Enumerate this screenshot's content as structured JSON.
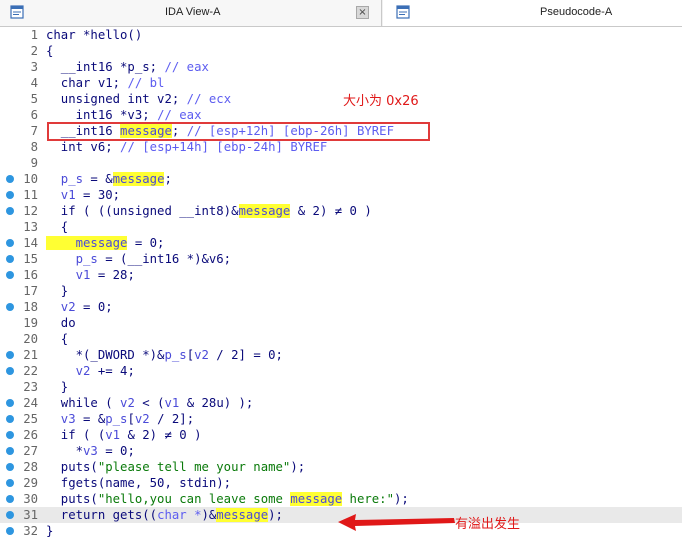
{
  "tabs": [
    {
      "title": "IDA View-A",
      "icon": "disassembly-view-icon",
      "close_glyph": "×"
    },
    {
      "title": "Pseudocode-A",
      "icon": "pseudocode-view-icon"
    }
  ],
  "annotations": {
    "size_note": "大小为 0x26",
    "overflow_note": "有溢出发生"
  },
  "colors": {
    "breakpoint": "#2e96e0",
    "highlight": "#ffff33",
    "annotation": "#e01818"
  },
  "code": {
    "lines": [
      {
        "n": "1",
        "bp": false,
        "parts": [
          [
            "k",
            "char *hello()"
          ]
        ]
      },
      {
        "n": "2",
        "bp": false,
        "parts": [
          [
            "k",
            "{"
          ]
        ]
      },
      {
        "n": "3",
        "bp": false,
        "parts": [
          [
            "k",
            "  __int16 *p_s; "
          ],
          [
            "c",
            "// eax"
          ]
        ]
      },
      {
        "n": "4",
        "bp": false,
        "parts": [
          [
            "k",
            "  char v1; "
          ],
          [
            "c",
            "// bl"
          ]
        ]
      },
      {
        "n": "5",
        "bp": false,
        "parts": [
          [
            "k",
            "  unsigned int v2; "
          ],
          [
            "c",
            "// ecx"
          ]
        ]
      },
      {
        "n": "6",
        "bp": false,
        "parts": [
          [
            "k",
            "    int16 *v3; "
          ],
          [
            "c",
            "// eax"
          ]
        ]
      },
      {
        "n": "7",
        "bp": false,
        "parts": [
          [
            "k",
            "  __int16 "
          ],
          [
            "y",
            "message"
          ],
          [
            "k",
            "; "
          ],
          [
            "c",
            "// [esp+12h] [ebp-26h] BYREF"
          ]
        ]
      },
      {
        "n": "8",
        "bp": false,
        "parts": [
          [
            "k",
            "  int v6; "
          ],
          [
            "c",
            "// [esp+14h] [ebp-24h] BYREF"
          ]
        ]
      },
      {
        "n": "9",
        "bp": false,
        "parts": [
          [
            "k",
            ""
          ]
        ]
      },
      {
        "n": "10",
        "bp": true,
        "parts": [
          [
            "v",
            "  p_s"
          ],
          [
            "k",
            " = &"
          ],
          [
            "y",
            "message"
          ],
          [
            "k",
            ";"
          ]
        ]
      },
      {
        "n": "11",
        "bp": true,
        "parts": [
          [
            "v",
            "  v1"
          ],
          [
            "k",
            " = 30;"
          ]
        ]
      },
      {
        "n": "12",
        "bp": true,
        "parts": [
          [
            "k",
            "  if ( ((unsigned __int8)&"
          ],
          [
            "y",
            "message"
          ],
          [
            "k",
            " & 2) ≠ 0 )"
          ]
        ]
      },
      {
        "n": "13",
        "bp": false,
        "parts": [
          [
            "k",
            "  {"
          ]
        ]
      },
      {
        "n": "14",
        "bp": true,
        "parts": [
          [
            "y",
            "    message"
          ],
          [
            "k",
            " = 0;"
          ]
        ]
      },
      {
        "n": "15",
        "bp": true,
        "parts": [
          [
            "v",
            "    p_s"
          ],
          [
            "k",
            " = (__int16 *)&v6;"
          ]
        ]
      },
      {
        "n": "16",
        "bp": true,
        "parts": [
          [
            "v",
            "    v1"
          ],
          [
            "k",
            " = 28;"
          ]
        ]
      },
      {
        "n": "17",
        "bp": false,
        "parts": [
          [
            "k",
            "  }"
          ]
        ]
      },
      {
        "n": "18",
        "bp": true,
        "parts": [
          [
            "v",
            "  v2"
          ],
          [
            "k",
            " = 0;"
          ]
        ]
      },
      {
        "n": "19",
        "bp": false,
        "parts": [
          [
            "k",
            "  do"
          ]
        ]
      },
      {
        "n": "20",
        "bp": false,
        "parts": [
          [
            "k",
            "  {"
          ]
        ]
      },
      {
        "n": "21",
        "bp": true,
        "parts": [
          [
            "k",
            "    *(_DWORD *)&"
          ],
          [
            "v",
            "p_s"
          ],
          [
            "k",
            "["
          ],
          [
            "v",
            "v2"
          ],
          [
            "k",
            " / 2] = 0;"
          ]
        ]
      },
      {
        "n": "22",
        "bp": true,
        "parts": [
          [
            "v",
            "    v2"
          ],
          [
            "k",
            " += 4;"
          ]
        ]
      },
      {
        "n": "23",
        "bp": false,
        "parts": [
          [
            "k",
            "  }"
          ]
        ]
      },
      {
        "n": "24",
        "bp": true,
        "parts": [
          [
            "k",
            "  while ( "
          ],
          [
            "v",
            "v2"
          ],
          [
            "k",
            " < ("
          ],
          [
            "v",
            "v1"
          ],
          [
            "k",
            " & 28u) );"
          ]
        ]
      },
      {
        "n": "25",
        "bp": true,
        "parts": [
          [
            "v",
            "  v3"
          ],
          [
            "k",
            " = &"
          ],
          [
            "v",
            "p_s"
          ],
          [
            "k",
            "["
          ],
          [
            "v",
            "v2"
          ],
          [
            "k",
            " / 2];"
          ]
        ]
      },
      {
        "n": "26",
        "bp": true,
        "parts": [
          [
            "k",
            "  if ( ("
          ],
          [
            "v",
            "v1"
          ],
          [
            "k",
            " & 2) ≠ 0 )"
          ]
        ]
      },
      {
        "n": "27",
        "bp": true,
        "parts": [
          [
            "k",
            "    *"
          ],
          [
            "v",
            "v3"
          ],
          [
            "k",
            " = 0;"
          ]
        ]
      },
      {
        "n": "28",
        "bp": true,
        "parts": [
          [
            "k",
            "  puts("
          ],
          [
            "s",
            "\"please tell me your name\""
          ],
          [
            "k",
            ");"
          ]
        ]
      },
      {
        "n": "29",
        "bp": true,
        "parts": [
          [
            "k",
            "  fgets(name, 50, stdin);"
          ]
        ]
      },
      {
        "n": "30",
        "bp": true,
        "parts": [
          [
            "k",
            "  puts("
          ],
          [
            "s",
            "\"hello,you can leave some "
          ],
          [
            "y",
            "message"
          ],
          [
            "s",
            " here:\""
          ],
          [
            "k",
            ");"
          ]
        ]
      },
      {
        "n": "31",
        "bp": true,
        "hl": true,
        "parts": [
          [
            "k",
            "  return gets(("
          ],
          [
            "c",
            "char *"
          ],
          [
            "k",
            ")&"
          ],
          [
            "y",
            "message"
          ],
          [
            "k",
            ");"
          ]
        ]
      },
      {
        "n": "32",
        "bp": true,
        "parts": [
          [
            "k",
            "}"
          ]
        ]
      }
    ]
  }
}
